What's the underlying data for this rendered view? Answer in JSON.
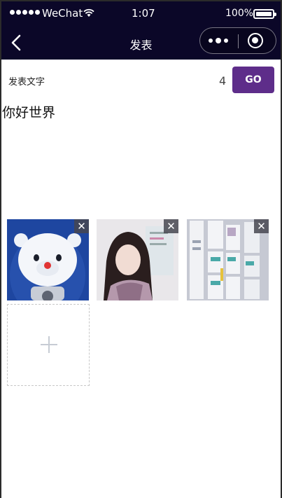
{
  "status_bar": {
    "carrier": "WeChat",
    "time": "1:07",
    "battery": "100%"
  },
  "nav": {
    "title": "发表",
    "back_icon": "chevron-left-icon",
    "more_icon": "more-dots-icon",
    "close_icon": "target-circle-icon"
  },
  "compose": {
    "label": "发表文字",
    "char_count": "4",
    "submit_label": "GO",
    "text": "你好世界",
    "accent_color": "#5e2d8a"
  },
  "images": [
    {
      "name": "astronaut-bear-image",
      "delete_label": "✕"
    },
    {
      "name": "girl-portrait-image",
      "delete_label": "✕"
    },
    {
      "name": "ui-screens-collage-image",
      "delete_label": "✕"
    }
  ],
  "add_button_icon": "plus-icon"
}
